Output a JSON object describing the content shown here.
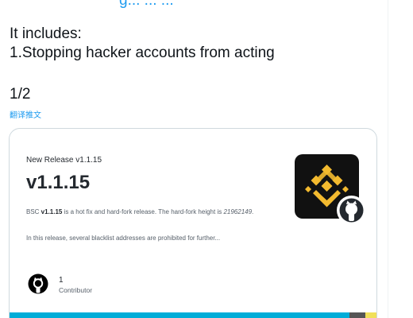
{
  "tweet": {
    "top_link_text": "g... ... ...",
    "line1": "It includes:",
    "line2": "1.Stopping hacker accounts from acting",
    "line3": "1/2",
    "translate": "翻译推文"
  },
  "card": {
    "subtitle": "New Release v1.1.15",
    "version": "v1.1.15",
    "desc_prefix": "BSC ",
    "desc_bold": "v1.1.15",
    "desc_mid": " is a hot fix and hard-fork release. The hard-fork height is ",
    "desc_italic": "21962149",
    "desc_suffix": ".",
    "desc2": "In this release, several blacklist addresses are prohibited for further...",
    "contributor_count": "1",
    "contributor_label": "Contributor",
    "language_colors": [
      "#00add8",
      "#00add8",
      "#555555",
      "#f1e05a"
    ],
    "logo_color": "#f3ba2f",
    "logo_bg": "#111111"
  },
  "colors": {
    "accent": "#1d9bf0",
    "text": "#0f1419",
    "card_border": "#cfd9de"
  }
}
